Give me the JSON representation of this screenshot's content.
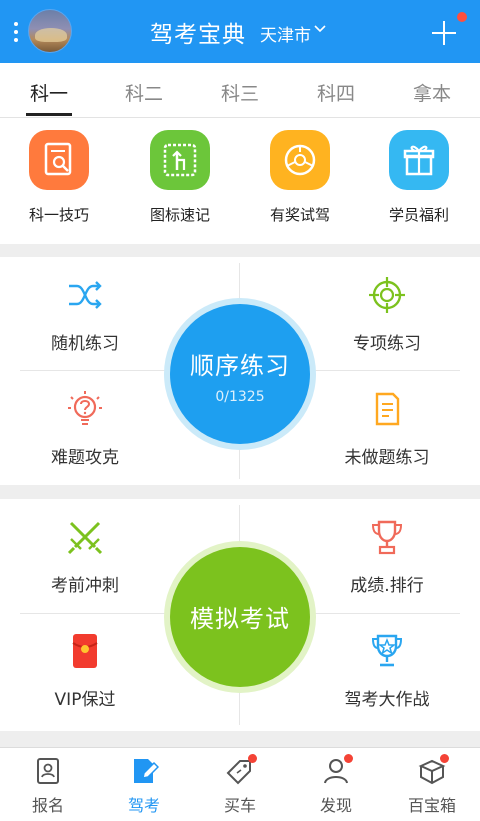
{
  "header": {
    "title": "驾考宝典",
    "city": "天津市",
    "menu_icon": "more-vertical-icon",
    "avatar_icon": "avatar",
    "add_icon": "plus-icon",
    "brand_color": "#2196f3"
  },
  "tabs": [
    {
      "label": "科一",
      "active": true
    },
    {
      "label": "科二",
      "active": false
    },
    {
      "label": "科三",
      "active": false
    },
    {
      "label": "科四",
      "active": false
    },
    {
      "label": "拿本",
      "active": false
    }
  ],
  "tools": [
    {
      "label": "科一技巧",
      "icon": "notebook-search-icon",
      "color": "#ff7a3d"
    },
    {
      "label": "图标速记",
      "icon": "road-sign-icon",
      "color": "#6cc63a"
    },
    {
      "label": "有奖试驾",
      "icon": "steering-wheel-icon",
      "color": "#ffb320"
    },
    {
      "label": "学员福利",
      "icon": "gift-icon",
      "color": "#35b8f2"
    }
  ],
  "practice": {
    "main": {
      "label": "顺序练习",
      "progress": "0/1325",
      "color": "#1e9ff0"
    },
    "cells": [
      {
        "label": "随机练习",
        "icon": "shuffle-icon"
      },
      {
        "label": "专项练习",
        "icon": "target-icon"
      },
      {
        "label": "难题攻克",
        "icon": "lightbulb-question-icon"
      },
      {
        "label": "未做题练习",
        "icon": "document-icon"
      }
    ]
  },
  "exam": {
    "main": {
      "label": "模拟考试",
      "color": "#7cc21e"
    },
    "cells": [
      {
        "label": "考前冲刺",
        "icon": "crossed-swords-icon"
      },
      {
        "label": "成绩.排行",
        "icon": "trophy-icon"
      },
      {
        "label": "VIP保过",
        "icon": "red-envelope-icon"
      },
      {
        "label": "驾考大作战",
        "icon": "cup-star-icon"
      }
    ]
  },
  "bottom_nav": [
    {
      "label": "报名",
      "icon": "id-card-icon",
      "active": false,
      "badge": false
    },
    {
      "label": "驾考",
      "icon": "edit-document-icon",
      "active": true,
      "badge": false
    },
    {
      "label": "买车",
      "icon": "price-tag-icon",
      "active": false,
      "badge": true
    },
    {
      "label": "发现",
      "icon": "person-icon",
      "active": false,
      "badge": true
    },
    {
      "label": "百宝箱",
      "icon": "treasure-box-icon",
      "active": false,
      "badge": true
    }
  ]
}
